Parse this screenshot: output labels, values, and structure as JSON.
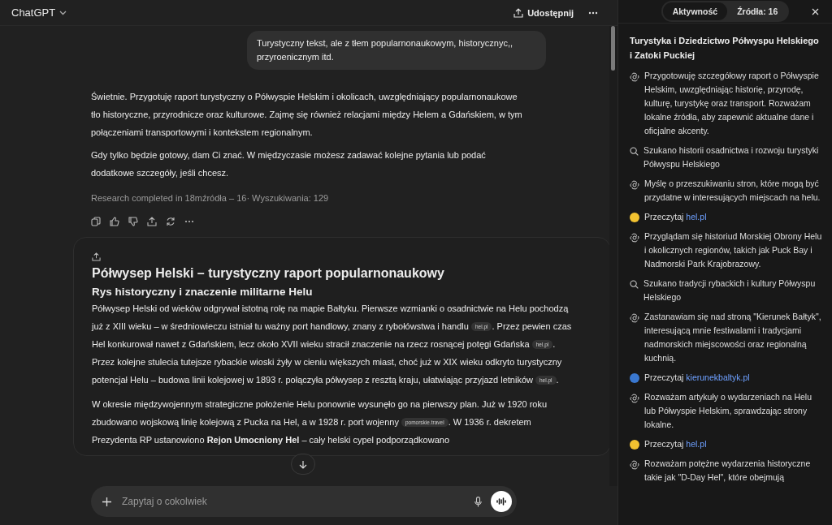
{
  "header": {
    "title": "ChatGPT",
    "share_label": "Udostępnij"
  },
  "user_message": "Turystyczny tekst, ale z tłem popularnonaukowym, historycznyc,, przyroenicznym itd.",
  "assistant_paragraphs": [
    "Świetnie. Przygotuję raport turystyczny o Półwyspie Helskim i okolicach, uwzględniający popularnonaukowe tło historyczne, przyrodnicze oraz kulturowe. Zajmę się również relacjami między Helem a Gdańskiem, w tym połączeniami transportowymi i kontekstem regionalnym.",
    "Gdy tylko będzie gotowy, dam Ci znać. W międzyczasie możesz zadawać kolejne pytania lub podać dodatkowe szczegóły, jeśli chcesz."
  ],
  "research_status": "Research completed in 18mźródła – 16· Wyszukiwania: 129",
  "report": {
    "title": "Półwysep Helski – turystyczny raport popularnonaukowy",
    "section_title": "Rys historyczny i znaczenie militarne Helu",
    "paragraphs": [
      [
        {
          "kind": "text",
          "text": "Półwysep Helski od wieków odgrywał istotną rolę na mapie Bałtyku. Pierwsze wzmianki o osadnictwie na Helu pochodzą już z XIII wieku – w średniowieczu istniał tu ważny port handlowy, znany z rybołówstwa i handlu "
        },
        {
          "kind": "source",
          "text": "hel.pl"
        },
        {
          "kind": "text",
          "text": ". Przez pewien czas Hel konkurował nawet z Gdańskiem, lecz około XVII wieku stracił znaczenie na rzecz rosnącej potęgi Gdańska "
        },
        {
          "kind": "source",
          "text": "hel.pl"
        },
        {
          "kind": "text",
          "text": ". Przez kolejne stulecia tutejsze rybackie wioski żyły w cieniu większych miast, choć już w XIX wieku odkryto turystyczny potencjał Helu – budowa linii kolejowej w 1893 r. połączyła półwysep z resztą kraju, ułatwiając przyjazd letników "
        },
        {
          "kind": "source",
          "text": "hel.pl"
        },
        {
          "kind": "text",
          "text": "."
        }
      ],
      [
        {
          "kind": "text",
          "text": "W okresie międzywojennym strategiczne położenie Helu ponownie wysunęło go na pierwszy plan. Już w 1920 roku zbudowano wojskową linię kolejową z Pucka na Hel, a w 1928 r. port wojenny "
        },
        {
          "kind": "source",
          "text": "pomorskie.travel"
        },
        {
          "kind": "text",
          "text": ". W 1936 r. dekretem Prezydenta RP ustanowiono **Rejon Umocniony Hel** – cały helski cypel podporządkowano"
        }
      ]
    ]
  },
  "composer": {
    "placeholder": "Zapytaj o cokolwiek"
  },
  "panel": {
    "tabs": [
      {
        "label": "Aktywność",
        "selected": true
      },
      {
        "label": "Źródła: 16",
        "selected": false
      }
    ],
    "title": "Turystyka i Dziedzictwo Półwyspu Helskiego i Zatoki Puckiej",
    "items": [
      {
        "kind": "thought",
        "text": "Przygotowuję szczegółowy raport o Półwyspie Helskim, uwzględniając historię, przyrodę, kulturę, turystykę oraz transport. Rozważam lokalne źródła, aby zapewnić aktualne dane i oficjalne akcenty."
      },
      {
        "kind": "search",
        "text": "Szukano historii osadnictwa i rozwoju turystyki Półwyspu Helskiego"
      },
      {
        "kind": "thought",
        "text": "Myślę o przeszukiwaniu stron, które mogą być przydatne w interesujących miejscach na helu."
      },
      {
        "kind": "read",
        "text": "Przeczytaj",
        "link": "hel.pl",
        "color": "#f2c230"
      },
      {
        "kind": "thought",
        "text": "Przyglądam się historiud Morskiej Obrony Helu i okolicznych regionów, takich jak Puck Bay i Nadmorski Park Krajobrazowy."
      },
      {
        "kind": "search",
        "text": "Szukano tradycji rybackich i kultury Półwyspu Helskiego"
      },
      {
        "kind": "thought",
        "text": "Zastanawiam się nad stroną \"Kierunek Bałtyk\", interesującą mnie festiwalami i tradycjami nadmorskich miejscowości oraz regionalną kuchnią."
      },
      {
        "kind": "read",
        "text": "Przeczytaj",
        "link": "kierunekbaltyk.pl",
        "color": "#3a78d0"
      },
      {
        "kind": "thought",
        "text": "Rozważam artykuły o wydarzeniach na Helu lub Półwyspie Helskim, sprawdzając strony lokalne."
      },
      {
        "kind": "read",
        "text": "Przeczytaj",
        "link": "hel.pl",
        "color": "#f2c230"
      },
      {
        "kind": "thought",
        "text": "Rozważam potężne wydarzenia historyczne takie jak \"D-Day Hel\", które obejmują"
      }
    ]
  }
}
